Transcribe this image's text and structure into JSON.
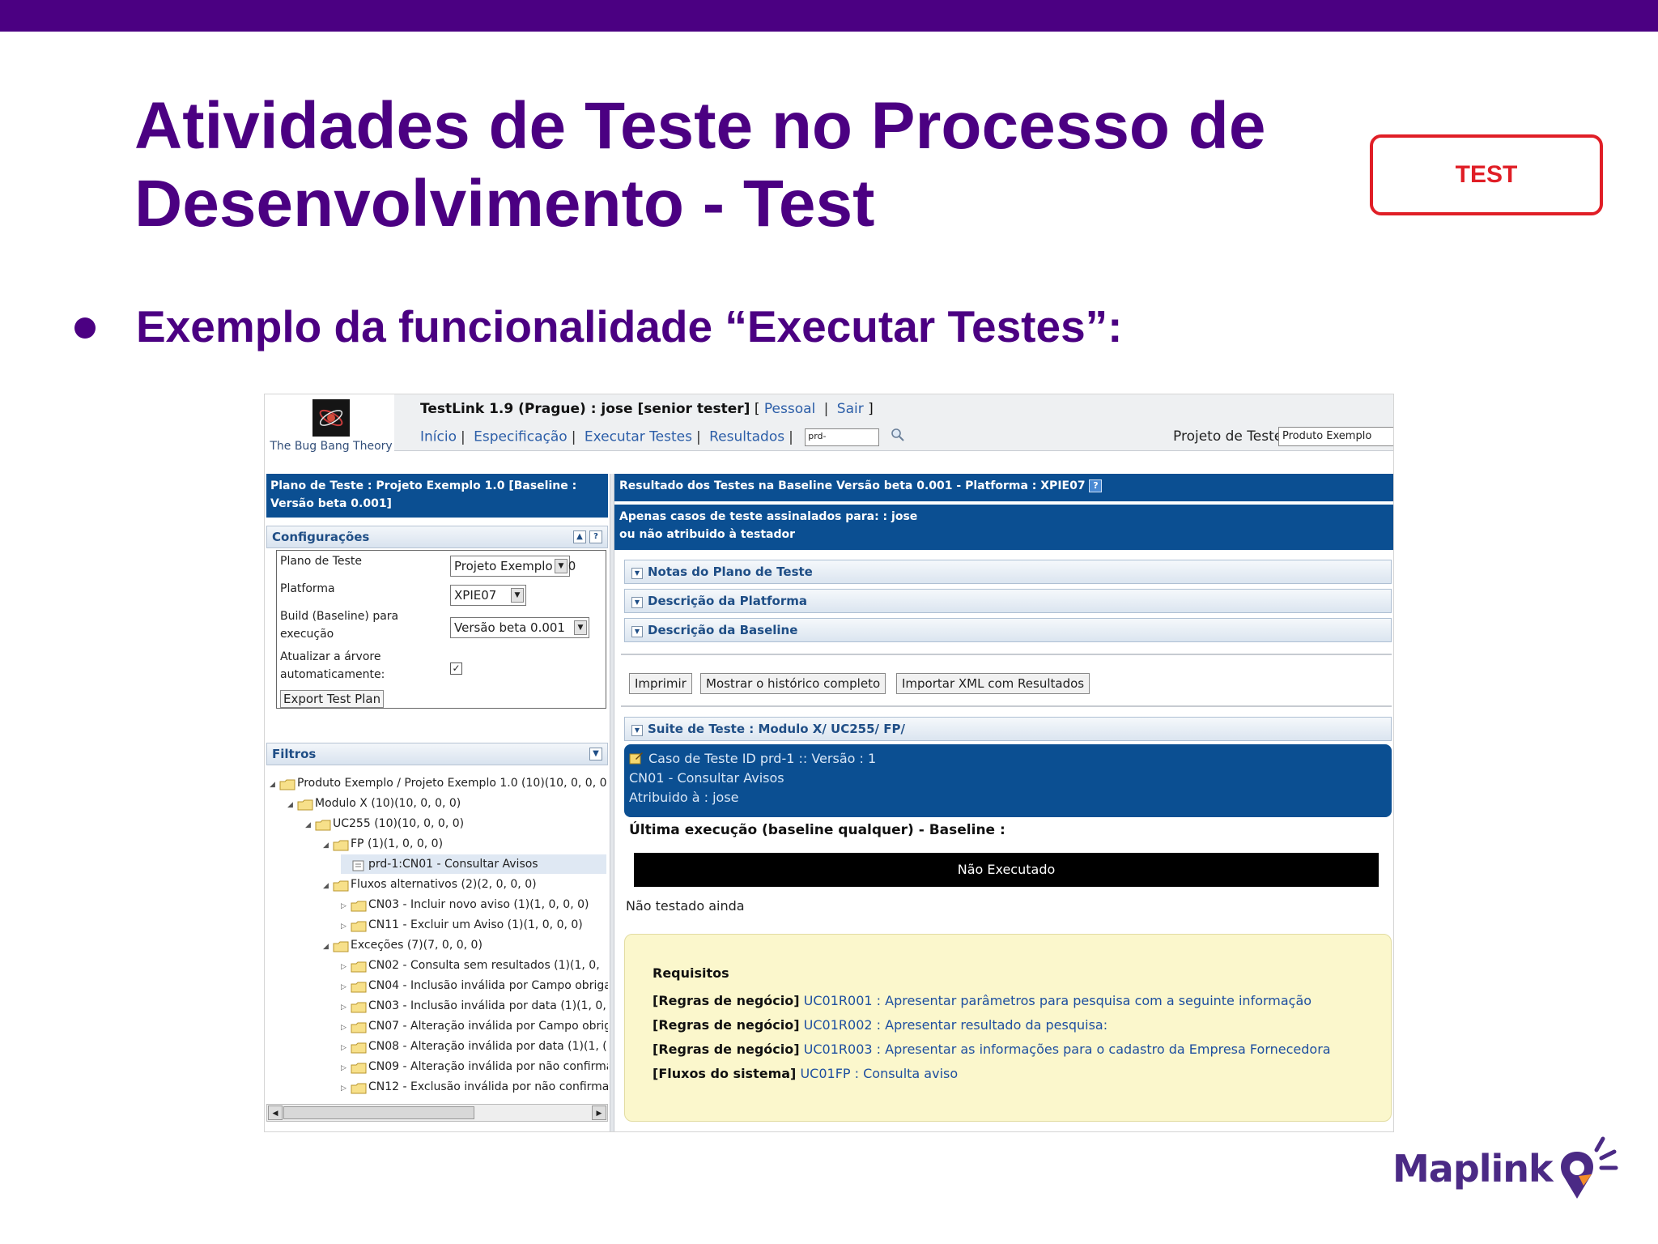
{
  "slide": {
    "title": "Atividades de Teste no Processo de Desenvolvimento - Test",
    "badge": "TEST",
    "bullet": "Exemplo da funcionalidade “Executar Testes”:",
    "brand": "Maplink",
    "colors": {
      "primary": "#4b0082",
      "badge": "#e01e26",
      "tl_blue": "#0b4f92",
      "req_bg": "#fbf7cc"
    }
  },
  "testlink": {
    "logo_text": "The Bug Bang Theory",
    "header": {
      "app": "TestLink 1.9 (Prague) : jose [senior tester]",
      "open_bracket": "[",
      "links": {
        "pessoal": "Pessoal",
        "sair": "Sair"
      },
      "close_bracket": "]",
      "nav": [
        "Início",
        "Especificação",
        "Executar Testes",
        "Resultados"
      ],
      "search_value": "prd-",
      "project_label": "Projeto de Teste",
      "project_value": "Produto Exemplo"
    },
    "left": {
      "plan_title": "Plano de Teste : Projeto Exemplo 1.0 [Baseline : Versão beta 0.001]",
      "config_header": "Configurações",
      "config": {
        "plan_label": "Plano de Teste",
        "plan_value": "Projeto Exemplo 1.0",
        "platform_label": "Platforma",
        "platform_value": "XPIE07",
        "build_label": "Build (Baseline) para execução",
        "build_value": "Versão beta 0.001",
        "auto_label": "Atualizar a árvore automaticamente:",
        "auto_checked": "✓",
        "export_button": "Export Test Plan"
      },
      "filters_header": "Filtros",
      "tree": [
        {
          "level": 0,
          "expanded": "◢",
          "label": "Produto Exemplo / Projeto Exemplo 1.0 (10)(10, 0, 0, 0"
        },
        {
          "level": 1,
          "expanded": "◢",
          "label": "Modulo X (10)(10, 0, 0, 0)"
        },
        {
          "level": 2,
          "expanded": "◢",
          "label": "UC255 (10)(10, 0, 0, 0)"
        },
        {
          "level": 3,
          "expanded": "◢",
          "label": "FP (1)(1, 0, 0, 0)"
        },
        {
          "level": 4,
          "expanded": "",
          "label": "prd-1:CN01 - Consultar Avisos",
          "case": true
        },
        {
          "level": 3,
          "expanded": "◢",
          "label": "Fluxos alternativos (2)(2, 0, 0, 0)"
        },
        {
          "level": 4,
          "expanded": "▷",
          "label": "CN03 - Incluir novo aviso (1)(1, 0, 0, 0)"
        },
        {
          "level": 4,
          "expanded": "▷",
          "label": "CN11 - Excluir um Aviso (1)(1, 0, 0, 0)"
        },
        {
          "level": 3,
          "expanded": "◢",
          "label": "Exceções (7)(7, 0, 0, 0)"
        },
        {
          "level": 4,
          "expanded": "▷",
          "label": "CN02 - Consulta sem resultados (1)(1, 0,"
        },
        {
          "level": 4,
          "expanded": "▷",
          "label": "CN04 - Inclusão inválida por Campo obriga"
        },
        {
          "level": 4,
          "expanded": "▷",
          "label": "CN03 - Inclusão inválida por data (1)(1, 0,"
        },
        {
          "level": 4,
          "expanded": "▷",
          "label": "CN07 - Alteração inválida por Campo obrig"
        },
        {
          "level": 4,
          "expanded": "▷",
          "label": "CN08 - Alteração inválida por data (1)(1, ("
        },
        {
          "level": 4,
          "expanded": "▷",
          "label": "CN09 - Alteração inválida por não confirma"
        },
        {
          "level": 4,
          "expanded": "▷",
          "label": "CN12 - Exclusão inválida por não confirma"
        }
      ]
    },
    "right": {
      "result_header": "Resultado dos Testes na Baseline Versão beta 0.001 - Platforma : XPIE07",
      "filter_note_1": "Apenas casos de teste assinalados para: : jose",
      "filter_note_2": "ou não atribuido à testador",
      "sections": [
        "Notas do Plano de Teste",
        "Descrição da Platforma",
        "Descrição da Baseline"
      ],
      "buttons": [
        "Imprimir",
        "Mostrar o histórico completo",
        "Importar XML com Resultados"
      ],
      "suite": "Suite de Teste : Modulo X/ UC255/ FP/",
      "case_line1": "Caso de Teste ID prd-1 :: Versão : 1",
      "case_line2": "CN01 - Consultar Avisos",
      "case_line3": "Atribuido à : jose",
      "last_exec": "Última execução (baseline qualquer) - Baseline :",
      "status": "Não Executado",
      "not_tested": "Não testado ainda",
      "requirements_title": "Requisitos",
      "requirements": [
        {
          "type": "[Regras de negócio]",
          "text": "UC01R001 : Apresentar parâmetros para pesquisa com a seguinte informação"
        },
        {
          "type": "[Regras de negócio]",
          "text": "UC01R002 : Apresentar resultado da pesquisa:"
        },
        {
          "type": "[Regras de negócio]",
          "text": "UC01R003 : Apresentar as informações para o cadastro da Empresa Fornecedora"
        },
        {
          "type": "[Fluxos do sistema]",
          "text": "UC01FP : Consulta aviso"
        }
      ]
    }
  }
}
